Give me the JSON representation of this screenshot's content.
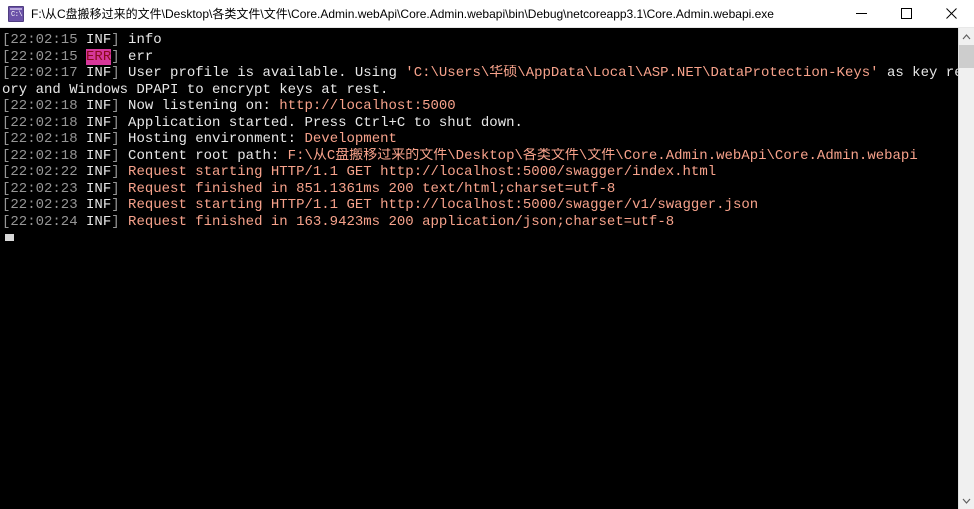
{
  "window": {
    "title": "F:\\从C盘搬移过来的文件\\Desktop\\各类文件\\文件\\Core.Admin.webApi\\Core.Admin.webapi\\bin\\Debug\\netcoreapp3.1\\Core.Admin.webapi.exe",
    "icon": "console-app-icon",
    "icon_glyph": "C:\\",
    "controls": {
      "minimize": "minimize-button",
      "maximize": "maximize-button",
      "close": "close-button"
    }
  },
  "colors": {
    "background": "#000000",
    "titlebar": "#ffffff",
    "timestamp": "#969696",
    "level_info": "#e8e8e8",
    "message": "#e8e8e8",
    "highlight": "#f7a28b",
    "error_text": "#8b0a1a",
    "error_background": "#d6379a",
    "icon": "#6b52a8",
    "scrollbar_track": "#f0f0f0",
    "scrollbar_thumb": "#cdcdcd"
  },
  "console": {
    "lines": [
      {
        "timestamp": "[22:02:15",
        "level": "INF",
        "level_kind": "info",
        "bracket": "]",
        "segments": [
          {
            "text": " info",
            "style": "msg"
          }
        ]
      },
      {
        "timestamp": "[22:02:15",
        "level": "ERR",
        "level_kind": "error",
        "bracket": "]",
        "segments": [
          {
            "text": " err",
            "style": "msg"
          }
        ]
      },
      {
        "timestamp": "[22:02:17",
        "level": "INF",
        "level_kind": "info",
        "bracket": "]",
        "segments": [
          {
            "text": " User profile is available. Using ",
            "style": "msg"
          },
          {
            "text": "'C:\\Users\\华硕\\AppData\\Local\\ASP.NET\\DataProtection-Keys'",
            "style": "hl"
          },
          {
            "text": " as key reposit",
            "style": "msg"
          }
        ]
      },
      {
        "timestamp": "",
        "level": "",
        "level_kind": "none",
        "bracket": "",
        "segments": [
          {
            "text": "ory and Windows DPAPI to encrypt keys at rest.",
            "style": "msg"
          }
        ]
      },
      {
        "timestamp": "[22:02:18",
        "level": "INF",
        "level_kind": "info",
        "bracket": "]",
        "segments": [
          {
            "text": " Now listening on: ",
            "style": "msg"
          },
          {
            "text": "http://localhost:5000",
            "style": "hl"
          }
        ]
      },
      {
        "timestamp": "[22:02:18",
        "level": "INF",
        "level_kind": "info",
        "bracket": "]",
        "segments": [
          {
            "text": " Application started. Press Ctrl+C to shut down.",
            "style": "msg"
          }
        ]
      },
      {
        "timestamp": "[22:02:18",
        "level": "INF",
        "level_kind": "info",
        "bracket": "]",
        "segments": [
          {
            "text": " Hosting environment: ",
            "style": "msg"
          },
          {
            "text": "Development",
            "style": "hl"
          }
        ]
      },
      {
        "timestamp": "[22:02:18",
        "level": "INF",
        "level_kind": "info",
        "bracket": "]",
        "segments": [
          {
            "text": " Content root path: ",
            "style": "msg"
          },
          {
            "text": "F:\\从C盘搬移过来的文件\\Desktop\\各类文件\\文件\\Core.Admin.webApi\\Core.Admin.webapi",
            "style": "hl"
          }
        ]
      },
      {
        "timestamp": "[22:02:22",
        "level": "INF",
        "level_kind": "info",
        "bracket": "]",
        "segments": [
          {
            "text": " Request starting HTTP/1.1 GET http://localhost:5000/swagger/index.html",
            "style": "hl"
          }
        ]
      },
      {
        "timestamp": "[22:02:23",
        "level": "INF",
        "level_kind": "info",
        "bracket": "]",
        "segments": [
          {
            "text": " Request finished in 851.1361ms 200 text/html;charset=utf-8",
            "style": "hl"
          }
        ]
      },
      {
        "timestamp": "[22:02:23",
        "level": "INF",
        "level_kind": "info",
        "bracket": "]",
        "segments": [
          {
            "text": " Request starting HTTP/1.1 GET http://localhost:5000/swagger/v1/swagger.json",
            "style": "hl"
          }
        ]
      },
      {
        "timestamp": "[22:02:24",
        "level": "INF",
        "level_kind": "info",
        "bracket": "]",
        "segments": [
          {
            "text": " Request finished in 163.9423ms 200 application/json;charset=utf-8",
            "style": "hl"
          }
        ]
      }
    ],
    "cursor": "block-cursor"
  },
  "scrollbar": {
    "up_arrow": "scroll-up-arrow",
    "down_arrow": "scroll-down-arrow",
    "thumb": "scroll-thumb"
  }
}
